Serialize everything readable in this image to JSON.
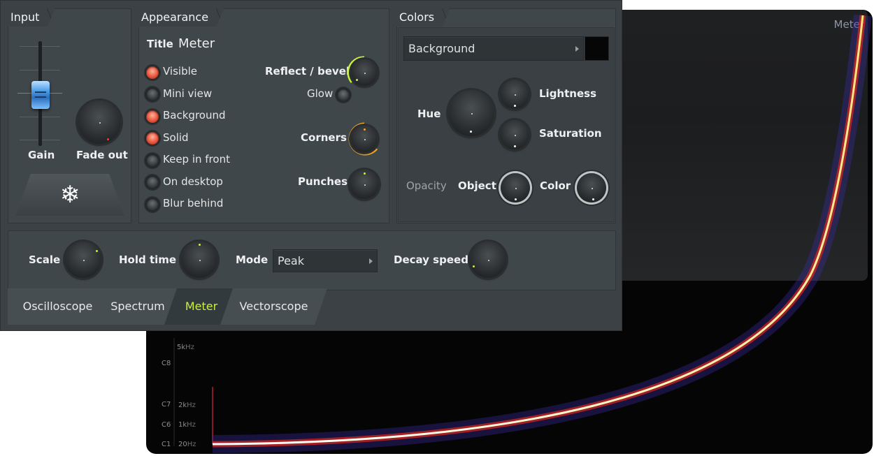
{
  "visualizer": {
    "title": "Meter",
    "notes": [
      {
        "note": "C8",
        "freq_value": "5k",
        "freq_unit": "Hz"
      },
      {
        "note": "C7",
        "freq_value": "2k",
        "freq_unit": "Hz"
      },
      {
        "note": "C6",
        "freq_value": "1k",
        "freq_unit": "Hz"
      },
      {
        "note": "C1",
        "freq_value": "20",
        "freq_unit": "Hz"
      }
    ]
  },
  "input": {
    "title": "Input",
    "gain_label": "Gain",
    "fade_label": "Fade out",
    "freeze_icon": "snowflake-icon",
    "freeze_glyph": "❄"
  },
  "appearance": {
    "title": "Appearance",
    "title_label": "Title",
    "title_value": "Meter",
    "options": [
      {
        "label": "Visible",
        "on": true
      },
      {
        "label": "Mini view",
        "on": false
      },
      {
        "label": "Background",
        "on": true
      },
      {
        "label": "Solid",
        "on": true
      },
      {
        "label": "Keep in front",
        "on": false
      },
      {
        "label": "On desktop",
        "on": false
      },
      {
        "label": "Blur behind",
        "on": false
      }
    ],
    "reflect_label": "Reflect / bevel",
    "glow_label": "Glow",
    "corners_label": "Corners",
    "punches_label": "Punches"
  },
  "colors": {
    "title": "Colors",
    "target_value": "Background",
    "swatch": "#060606",
    "hue_label": "Hue",
    "lightness_label": "Lightness",
    "saturation_label": "Saturation",
    "opacity_label": "Opacity",
    "object_label": "Object",
    "color_label": "Color"
  },
  "bottom": {
    "scale_label": "Scale",
    "hold_label": "Hold time",
    "mode_label": "Mode",
    "mode_value": "Peak",
    "decay_label": "Decay speed"
  },
  "tabs": [
    {
      "label": "Oscilloscope",
      "active": false
    },
    {
      "label": "Spectrum",
      "active": false
    },
    {
      "label": "Meter",
      "active": true
    },
    {
      "label": "Vectorscope",
      "active": false
    }
  ],
  "palette": {
    "accent_green": "#c8f23c",
    "accent_orange": "#f0a624",
    "radio_on": "#e8553b",
    "fader_blue": "#4d9ee8"
  }
}
